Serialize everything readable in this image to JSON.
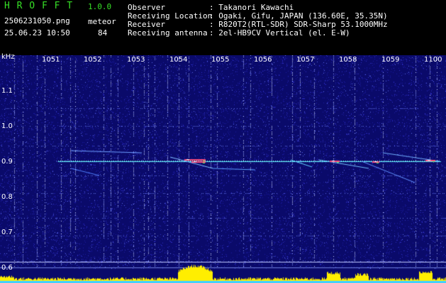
{
  "header": {
    "app_name": "H R O F F T",
    "version": "1.0.0",
    "filename": "2506231050.png",
    "mode": "meteor",
    "datetime": "25.06.23 10:50",
    "count": "84",
    "info_labels": [
      "Observer",
      "Receiving Location",
      "Receiver",
      "Receiving antenna"
    ],
    "info_values": [
      ": Takanori Kawachi",
      ": Ogaki, Gifu, JAPAN (136.60E, 35.35N)",
      ": R820T2(RTL-SDR) SDR-Sharp 53.1000MHz",
      ": 2el-HB9CV Vertical (el. E-W)"
    ]
  },
  "spectrogram": {
    "y_unit": "kHz",
    "y_ticks": [
      "1.1",
      "1.0",
      "0.9",
      "0.8",
      "0.7",
      "0.6"
    ],
    "x_ticks": [
      "1051",
      "1052",
      "1053",
      "1054",
      "1055",
      "1056",
      "1057",
      "1058",
      "1059",
      "1100"
    ],
    "colors": {
      "background": "#0a0a6a",
      "noise": "#3030c8",
      "carrier": "#60f0ff",
      "echo": "#ff5080",
      "amplitude": "#ffee00",
      "grid_major": "#b0c0ff"
    }
  }
}
